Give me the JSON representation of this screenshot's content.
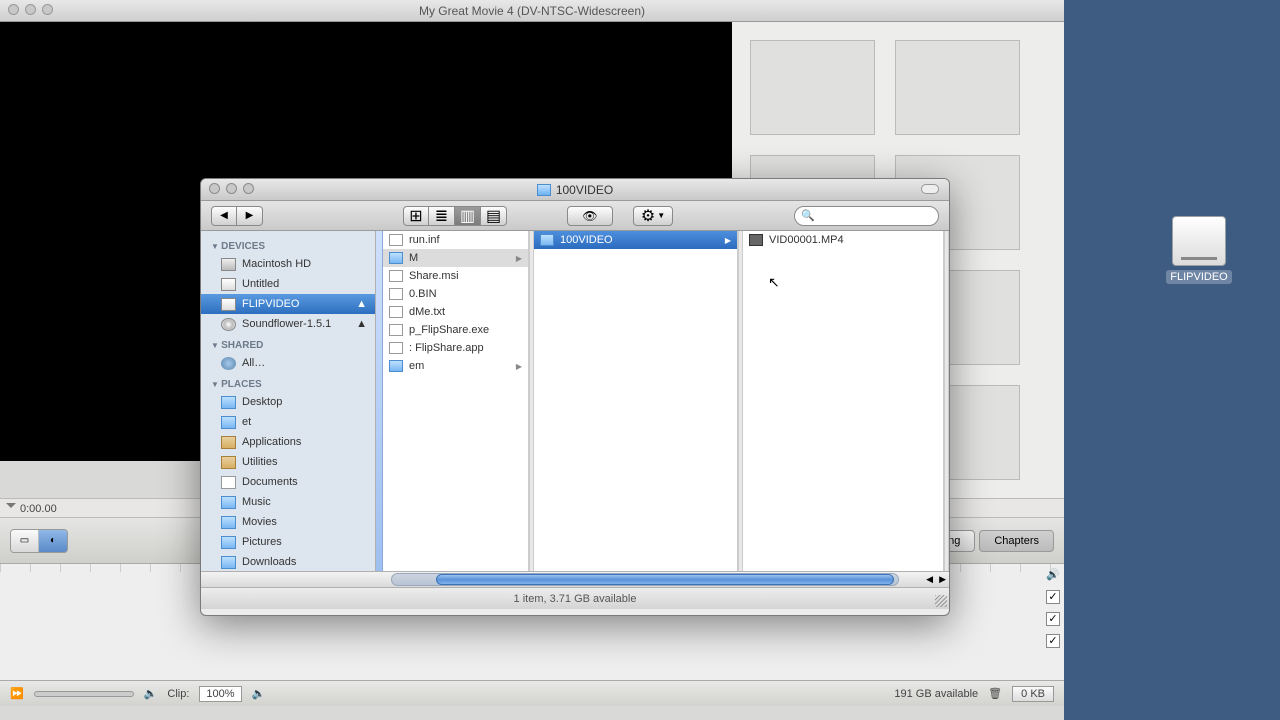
{
  "imovie": {
    "title": "My Great Movie 4 (DV-NTSC-Widescreen)",
    "playhead": "0:00.00",
    "tabs": {
      "editing": "…ing",
      "chapters": "Chapters"
    },
    "footer": {
      "clip_label": "Clip:",
      "zoom": "100%",
      "avail": "191 GB available",
      "kb": "0 KB"
    }
  },
  "finder": {
    "title": "100VIDEO",
    "sidebar": {
      "sections": [
        {
          "head": "DEVICES",
          "items": [
            {
              "label": "Macintosh HD",
              "icon": "ic-hd"
            },
            {
              "label": "Untitled",
              "icon": "ic-hdw"
            },
            {
              "label": "FLIPVIDEO",
              "icon": "ic-hdw",
              "selected": true,
              "eject": "▲"
            },
            {
              "label": "Soundflower-1.5.1",
              "icon": "ic-disc",
              "eject": "▲"
            }
          ]
        },
        {
          "head": "SHARED",
          "items": [
            {
              "label": "All…",
              "icon": "ic-glb"
            }
          ]
        },
        {
          "head": "PLACES",
          "items": [
            {
              "label": "Desktop",
              "icon": "ic-fld"
            },
            {
              "label": "et",
              "icon": "ic-fld"
            },
            {
              "label": "Applications",
              "icon": "ic-app"
            },
            {
              "label": "Utilities",
              "icon": "ic-app"
            },
            {
              "label": "Documents",
              "icon": "ic-doc"
            },
            {
              "label": "Music",
              "icon": "ic-fld"
            },
            {
              "label": "Movies",
              "icon": "ic-fld"
            },
            {
              "label": "Pictures",
              "icon": "ic-fld"
            },
            {
              "label": "Downloads",
              "icon": "ic-fld"
            }
          ]
        }
      ]
    },
    "col1": [
      {
        "label": "run.inf",
        "type": "doc"
      },
      {
        "label": "M",
        "type": "folder",
        "sel": "plain"
      },
      {
        "label": "Share.msi",
        "type": "doc"
      },
      {
        "label": "0.BIN",
        "type": "doc"
      },
      {
        "label": "dMe.txt",
        "type": "doc"
      },
      {
        "label": "p_FlipShare.exe",
        "type": "doc"
      },
      {
        "label": ": FlipShare.app",
        "type": "doc"
      },
      {
        "label": "em",
        "type": "folder"
      }
    ],
    "col2": [
      {
        "label": "100VIDEO",
        "type": "folder",
        "sel": "fld"
      }
    ],
    "col3": [
      {
        "label": "VID00001.MP4",
        "type": "mov"
      }
    ],
    "status": "1 item, 3.71 GB available"
  },
  "desktop": {
    "drive": "FLIPVIDEO"
  }
}
